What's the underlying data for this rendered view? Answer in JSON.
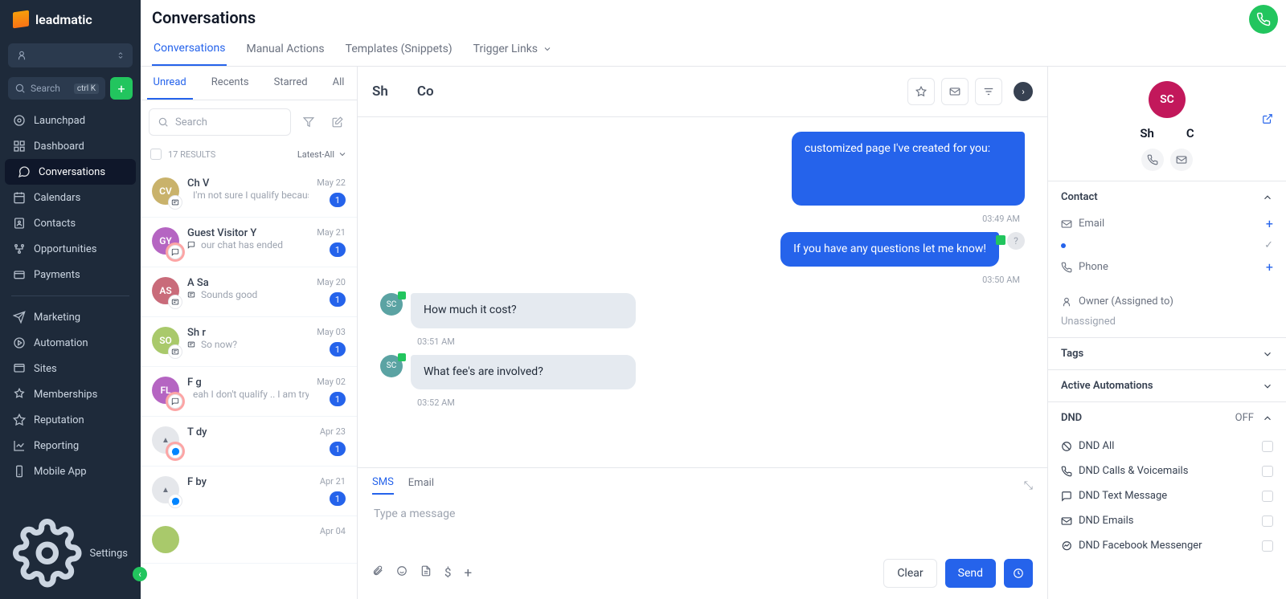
{
  "brand": "leadmatic",
  "search_placeholder": "Search",
  "search_kbd": "ctrl K",
  "nav": {
    "launchpad": "Launchpad",
    "dashboard": "Dashboard",
    "conversations": "Conversations",
    "calendars": "Calendars",
    "contacts": "Contacts",
    "opportunities": "Opportunities",
    "payments": "Payments",
    "marketing": "Marketing",
    "automation": "Automation",
    "sites": "Sites",
    "memberships": "Memberships",
    "reputation": "Reputation",
    "reporting": "Reporting",
    "mobile": "Mobile App",
    "settings": "Settings"
  },
  "page_title": "Conversations",
  "subtabs": {
    "conversations": "Conversations",
    "manual": "Manual Actions",
    "templates": "Templates (Snippets)",
    "trigger": "Trigger Links"
  },
  "filters": {
    "unread": "Unread",
    "recents": "Recents",
    "starred": "Starred",
    "all": "All"
  },
  "list_search_placeholder": "Search",
  "results_label": "17 RESULTS",
  "sort_label": "Latest-All",
  "conversations_list": [
    {
      "initials": "CV",
      "color": "#c9b26b",
      "name": "Ch        V",
      "preview": "I'm not sure I qualify because I'v",
      "date": "May 22",
      "badge": "1",
      "channel": "sms"
    },
    {
      "initials": "GY",
      "color": "#b565c2",
      "name": "Guest Visitor Y",
      "preview": "our chat has ended",
      "date": "May 21",
      "badge": "1",
      "channel": "chat",
      "ring": true
    },
    {
      "initials": "AS",
      "color": "#c96b7a",
      "name": "A        Sa",
      "preview": "Sounds good",
      "date": "May 20",
      "badge": "1",
      "channel": "sms"
    },
    {
      "initials": "SO",
      "color": "#a9c96b",
      "name": "Sh        r",
      "preview": "So now?",
      "date": "May 03",
      "badge": "1",
      "channel": "sms"
    },
    {
      "initials": "FL",
      "color": "#b565c2",
      "name": "F          g",
      "preview": "eah I don't qualify .. I am trying",
      "date": "May 02",
      "badge": "1",
      "channel": "chat",
      "ring": true
    },
    {
      "initials": "",
      "color": "#e5e7eb",
      "name": "T          dy",
      "preview": "",
      "date": "Apr 23",
      "badge": "1",
      "channel": "messenger",
      "ring": true,
      "img": true
    },
    {
      "initials": "",
      "color": "#e5e7eb",
      "name": "F          by",
      "preview": "",
      "date": "Apr 21",
      "badge": "1",
      "channel": "messenger",
      "img": true
    },
    {
      "initials": "",
      "color": "#a9c96b",
      "name": "",
      "preview": "",
      "date": "Apr 04",
      "badge": "",
      "channel": ""
    }
  ],
  "thread": {
    "title_a": "Sh",
    "title_b": "Co",
    "messages": [
      {
        "dir": "out",
        "text": "customized page I've created for you:",
        "time": "03:49 AM",
        "tall": true
      },
      {
        "dir": "out",
        "text": "If you have any questions let me know!",
        "time": "03:50 AM",
        "indicator": true
      },
      {
        "dir": "in",
        "avatar": "SC",
        "text": "How much it cost?",
        "time": "03:51 AM"
      },
      {
        "dir": "in",
        "avatar": "SC",
        "text": "What fee's are involved?",
        "time": "03:52 AM"
      }
    ]
  },
  "composer": {
    "tab_sms": "SMS",
    "tab_email": "Email",
    "placeholder": "Type a message",
    "clear": "Clear",
    "send": "Send"
  },
  "right": {
    "avatar": "SC",
    "name_a": "Sh",
    "name_b": "C",
    "contact_section": "Contact",
    "email_label": "Email",
    "phone_label": "Phone",
    "owner_label": "Owner (Assigned to)",
    "owner_value": "Unassigned",
    "tags": "Tags",
    "automations": "Active Automations",
    "dnd": "DND",
    "dnd_state": "OFF",
    "dnd_all": "DND All",
    "dnd_calls": "DND Calls & Voicemails",
    "dnd_text": "DND Text Message",
    "dnd_emails": "DND Emails",
    "dnd_fb": "DND Facebook Messenger"
  }
}
